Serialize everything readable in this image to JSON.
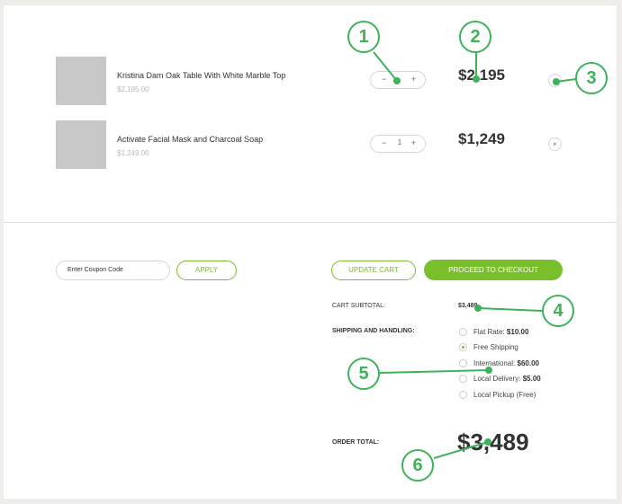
{
  "cart": {
    "items": [
      {
        "name": "Kristina Dam Oak Table With White Marble Top",
        "unit_price": "$2,195.00",
        "quantity": "",
        "minus": "−",
        "plus": "+",
        "total": "$2,195",
        "remove_icon": "close-icon",
        "remove": "×"
      },
      {
        "name": "Activate Facial Mask and Charcoal Soap",
        "unit_price": "$1,249.00",
        "quantity": "1",
        "minus": "−",
        "plus": "+",
        "total": "$1,249",
        "remove_icon": "close-icon",
        "remove": "×"
      }
    ]
  },
  "coupon": {
    "placeholder": "Enter Coupon Code",
    "apply_label": "APPLY"
  },
  "actions": {
    "update_label": "UPDATE CART",
    "checkout_label": "PROCEED TO CHECKOUT"
  },
  "summary": {
    "subtotal_label": "CART SUBTOTAL:",
    "subtotal_value": "$3,489",
    "shipping_label": "SHIPPING AND HANDLING:",
    "shipping_options": [
      {
        "label": "Flat Rate:",
        "price": "$10.00",
        "selected": false
      },
      {
        "label": "Free Shipping",
        "price": "",
        "selected": true
      },
      {
        "label": "International:",
        "price": "$60.00",
        "selected": false
      },
      {
        "label": "Local Delivery:",
        "price": "$5.00",
        "selected": false
      },
      {
        "label": "Local Pickup (Free)",
        "price": "",
        "selected": false
      }
    ],
    "order_total_label": "ORDER TOTAL:",
    "order_total_value": "$3,489"
  },
  "annotations": [
    "1",
    "2",
    "3",
    "4",
    "5",
    "6"
  ],
  "colors": {
    "accent": "#79be2b",
    "marker": "#3fb25a",
    "background": "#efedea"
  }
}
